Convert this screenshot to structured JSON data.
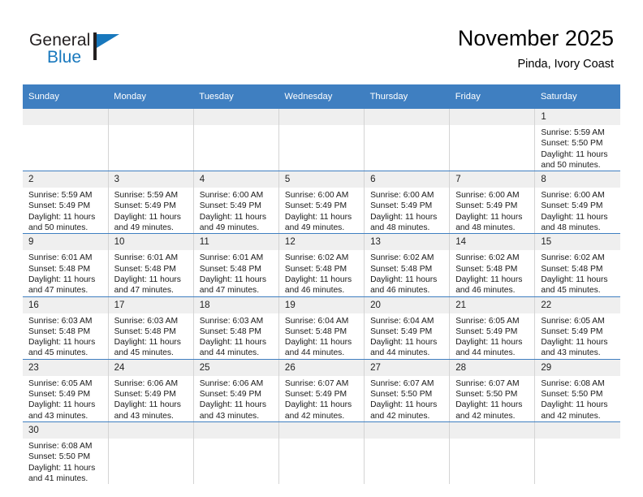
{
  "brand": {
    "name_part1": "General",
    "name_part2": "Blue",
    "accent_color": "#1878bd"
  },
  "header": {
    "title": "November 2025",
    "subtitle": "Pinda, Ivory Coast",
    "header_bar_color": "#3f7fc1"
  },
  "weekdays": [
    "Sunday",
    "Monday",
    "Tuesday",
    "Wednesday",
    "Thursday",
    "Friday",
    "Saturday"
  ],
  "labels": {
    "sunrise": "Sunrise:",
    "sunset": "Sunset:",
    "daylight": "Daylight:"
  },
  "weeks": [
    [
      {
        "day": "",
        "empty": true
      },
      {
        "day": "",
        "empty": true
      },
      {
        "day": "",
        "empty": true
      },
      {
        "day": "",
        "empty": true
      },
      {
        "day": "",
        "empty": true
      },
      {
        "day": "",
        "empty": true
      },
      {
        "day": "1",
        "sunrise": "Sunrise: 5:59 AM",
        "sunset": "Sunset: 5:50 PM",
        "daylight1": "Daylight: 11 hours",
        "daylight2": "and 50 minutes."
      }
    ],
    [
      {
        "day": "2",
        "sunrise": "Sunrise: 5:59 AM",
        "sunset": "Sunset: 5:49 PM",
        "daylight1": "Daylight: 11 hours",
        "daylight2": "and 50 minutes."
      },
      {
        "day": "3",
        "sunrise": "Sunrise: 5:59 AM",
        "sunset": "Sunset: 5:49 PM",
        "daylight1": "Daylight: 11 hours",
        "daylight2": "and 49 minutes."
      },
      {
        "day": "4",
        "sunrise": "Sunrise: 6:00 AM",
        "sunset": "Sunset: 5:49 PM",
        "daylight1": "Daylight: 11 hours",
        "daylight2": "and 49 minutes."
      },
      {
        "day": "5",
        "sunrise": "Sunrise: 6:00 AM",
        "sunset": "Sunset: 5:49 PM",
        "daylight1": "Daylight: 11 hours",
        "daylight2": "and 49 minutes."
      },
      {
        "day": "6",
        "sunrise": "Sunrise: 6:00 AM",
        "sunset": "Sunset: 5:49 PM",
        "daylight1": "Daylight: 11 hours",
        "daylight2": "and 48 minutes."
      },
      {
        "day": "7",
        "sunrise": "Sunrise: 6:00 AM",
        "sunset": "Sunset: 5:49 PM",
        "daylight1": "Daylight: 11 hours",
        "daylight2": "and 48 minutes."
      },
      {
        "day": "8",
        "sunrise": "Sunrise: 6:00 AM",
        "sunset": "Sunset: 5:49 PM",
        "daylight1": "Daylight: 11 hours",
        "daylight2": "and 48 minutes."
      }
    ],
    [
      {
        "day": "9",
        "sunrise": "Sunrise: 6:01 AM",
        "sunset": "Sunset: 5:48 PM",
        "daylight1": "Daylight: 11 hours",
        "daylight2": "and 47 minutes."
      },
      {
        "day": "10",
        "sunrise": "Sunrise: 6:01 AM",
        "sunset": "Sunset: 5:48 PM",
        "daylight1": "Daylight: 11 hours",
        "daylight2": "and 47 minutes."
      },
      {
        "day": "11",
        "sunrise": "Sunrise: 6:01 AM",
        "sunset": "Sunset: 5:48 PM",
        "daylight1": "Daylight: 11 hours",
        "daylight2": "and 47 minutes."
      },
      {
        "day": "12",
        "sunrise": "Sunrise: 6:02 AM",
        "sunset": "Sunset: 5:48 PM",
        "daylight1": "Daylight: 11 hours",
        "daylight2": "and 46 minutes."
      },
      {
        "day": "13",
        "sunrise": "Sunrise: 6:02 AM",
        "sunset": "Sunset: 5:48 PM",
        "daylight1": "Daylight: 11 hours",
        "daylight2": "and 46 minutes."
      },
      {
        "day": "14",
        "sunrise": "Sunrise: 6:02 AM",
        "sunset": "Sunset: 5:48 PM",
        "daylight1": "Daylight: 11 hours",
        "daylight2": "and 46 minutes."
      },
      {
        "day": "15",
        "sunrise": "Sunrise: 6:02 AM",
        "sunset": "Sunset: 5:48 PM",
        "daylight1": "Daylight: 11 hours",
        "daylight2": "and 45 minutes."
      }
    ],
    [
      {
        "day": "16",
        "sunrise": "Sunrise: 6:03 AM",
        "sunset": "Sunset: 5:48 PM",
        "daylight1": "Daylight: 11 hours",
        "daylight2": "and 45 minutes."
      },
      {
        "day": "17",
        "sunrise": "Sunrise: 6:03 AM",
        "sunset": "Sunset: 5:48 PM",
        "daylight1": "Daylight: 11 hours",
        "daylight2": "and 45 minutes."
      },
      {
        "day": "18",
        "sunrise": "Sunrise: 6:03 AM",
        "sunset": "Sunset: 5:48 PM",
        "daylight1": "Daylight: 11 hours",
        "daylight2": "and 44 minutes."
      },
      {
        "day": "19",
        "sunrise": "Sunrise: 6:04 AM",
        "sunset": "Sunset: 5:48 PM",
        "daylight1": "Daylight: 11 hours",
        "daylight2": "and 44 minutes."
      },
      {
        "day": "20",
        "sunrise": "Sunrise: 6:04 AM",
        "sunset": "Sunset: 5:49 PM",
        "daylight1": "Daylight: 11 hours",
        "daylight2": "and 44 minutes."
      },
      {
        "day": "21",
        "sunrise": "Sunrise: 6:05 AM",
        "sunset": "Sunset: 5:49 PM",
        "daylight1": "Daylight: 11 hours",
        "daylight2": "and 44 minutes."
      },
      {
        "day": "22",
        "sunrise": "Sunrise: 6:05 AM",
        "sunset": "Sunset: 5:49 PM",
        "daylight1": "Daylight: 11 hours",
        "daylight2": "and 43 minutes."
      }
    ],
    [
      {
        "day": "23",
        "sunrise": "Sunrise: 6:05 AM",
        "sunset": "Sunset: 5:49 PM",
        "daylight1": "Daylight: 11 hours",
        "daylight2": "and 43 minutes."
      },
      {
        "day": "24",
        "sunrise": "Sunrise: 6:06 AM",
        "sunset": "Sunset: 5:49 PM",
        "daylight1": "Daylight: 11 hours",
        "daylight2": "and 43 minutes."
      },
      {
        "day": "25",
        "sunrise": "Sunrise: 6:06 AM",
        "sunset": "Sunset: 5:49 PM",
        "daylight1": "Daylight: 11 hours",
        "daylight2": "and 43 minutes."
      },
      {
        "day": "26",
        "sunrise": "Sunrise: 6:07 AM",
        "sunset": "Sunset: 5:49 PM",
        "daylight1": "Daylight: 11 hours",
        "daylight2": "and 42 minutes."
      },
      {
        "day": "27",
        "sunrise": "Sunrise: 6:07 AM",
        "sunset": "Sunset: 5:50 PM",
        "daylight1": "Daylight: 11 hours",
        "daylight2": "and 42 minutes."
      },
      {
        "day": "28",
        "sunrise": "Sunrise: 6:07 AM",
        "sunset": "Sunset: 5:50 PM",
        "daylight1": "Daylight: 11 hours",
        "daylight2": "and 42 minutes."
      },
      {
        "day": "29",
        "sunrise": "Sunrise: 6:08 AM",
        "sunset": "Sunset: 5:50 PM",
        "daylight1": "Daylight: 11 hours",
        "daylight2": "and 42 minutes."
      }
    ],
    [
      {
        "day": "30",
        "sunrise": "Sunrise: 6:08 AM",
        "sunset": "Sunset: 5:50 PM",
        "daylight1": "Daylight: 11 hours",
        "daylight2": "and 41 minutes."
      },
      {
        "day": "",
        "empty": true
      },
      {
        "day": "",
        "empty": true
      },
      {
        "day": "",
        "empty": true
      },
      {
        "day": "",
        "empty": true
      },
      {
        "day": "",
        "empty": true
      },
      {
        "day": "",
        "empty": true
      }
    ]
  ]
}
